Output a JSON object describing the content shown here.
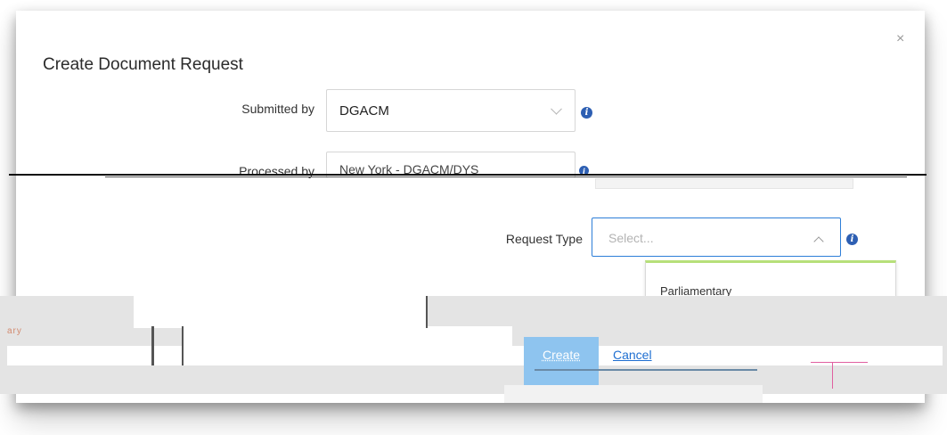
{
  "modal": {
    "title": "Create Document Request",
    "close_symbol": "×"
  },
  "form": {
    "submitted_by": {
      "label": "Submitted by",
      "value": "DGACM"
    },
    "processed_by": {
      "label": "Processed by",
      "value": "New York - DGACM/DYS"
    },
    "request_type": {
      "label": "Request Type",
      "placeholder": "Select..."
    }
  },
  "dropdown": {
    "options": [
      "Parliamentary"
    ]
  },
  "actions": {
    "create_label": "Create",
    "cancel_label": "Cancel"
  },
  "fragments": {
    "left_edge": "ary"
  },
  "colors": {
    "accent_blue": "#2d7ed8",
    "info_icon": "#2d5fb3",
    "create_button": "#8ec4ef",
    "link": "#1f6fd1"
  },
  "icons": {
    "info": "info-icon",
    "chevron_down": "chevron-down-icon",
    "chevron_up": "chevron-up-icon",
    "close": "close-icon"
  }
}
